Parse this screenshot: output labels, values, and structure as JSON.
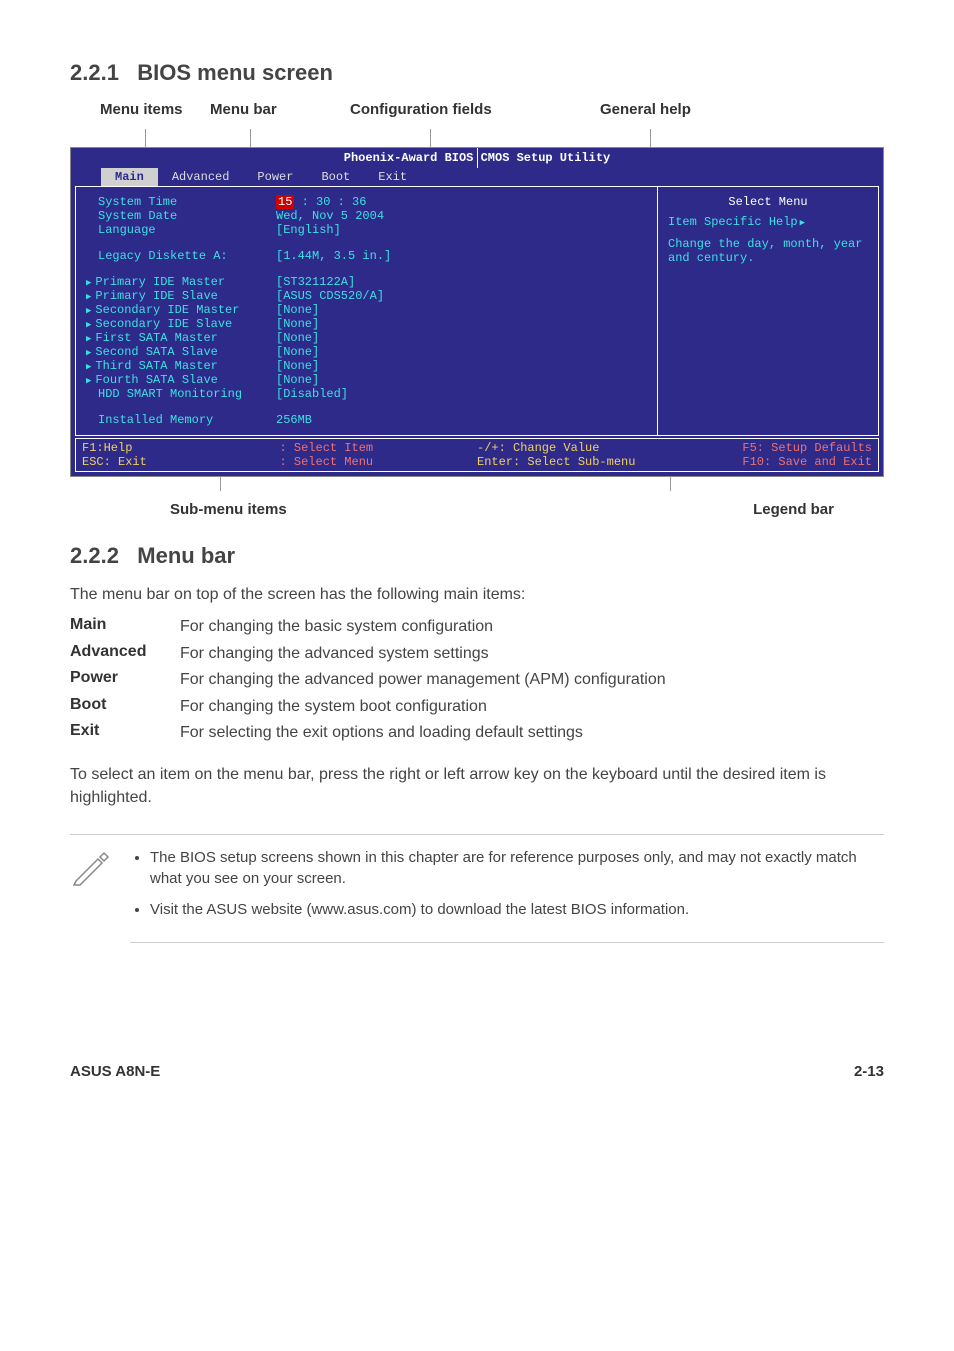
{
  "section1": {
    "number": "2.2.1",
    "title": "BIOS menu screen",
    "annotations": {
      "menu_items": "Menu items",
      "menu_bar": "Menu bar",
      "config_fields": "Configuration fields",
      "general_help": "General help",
      "submenu": "Sub-menu items",
      "legend": "Legend bar"
    }
  },
  "bios": {
    "title_left": "Phoenix-Award BIOS",
    "title_right": "CMOS Setup Utility",
    "tabs": [
      "Main",
      "Advanced",
      "Power",
      "Boot",
      "Exit"
    ],
    "active_tab": 0,
    "rows": [
      {
        "label": "System Time",
        "value_parts": {
          "h": "15",
          "m": "30",
          "s": "36"
        },
        "type": "time"
      },
      {
        "label": "System Date",
        "value": "Wed, Nov 5 2004"
      },
      {
        "label": "Language",
        "value": "[English]"
      },
      {
        "spacer": true
      },
      {
        "label": "Legacy Diskette A:",
        "value": "[1.44M, 3.5 in.]"
      },
      {
        "spacer": true
      },
      {
        "label": "Primary IDE Master",
        "value": "[ST321122A]",
        "submenu": true
      },
      {
        "label": "Primary IDE Slave",
        "value": "[ASUS CDS520/A]",
        "submenu": true
      },
      {
        "label": "Secondary IDE Master",
        "value": "[None]",
        "submenu": true
      },
      {
        "label": "Secondary IDE Slave",
        "value": "[None]",
        "submenu": true
      },
      {
        "label": "First SATA Master",
        "value": "[None]",
        "submenu": true
      },
      {
        "label": "Second SATA Slave",
        "value": "[None]",
        "submenu": true
      },
      {
        "label": "Third SATA Master",
        "value": "[None]",
        "submenu": true
      },
      {
        "label": "Fourth SATA Slave",
        "value": "[None]",
        "submenu": true
      },
      {
        "label": "HDD SMART Monitoring",
        "value": "[Disabled]"
      },
      {
        "spacer": true
      },
      {
        "label": "Installed Memory",
        "value": "256MB"
      }
    ],
    "help": {
      "title": "Select Menu",
      "item_label": "Item Specific Help",
      "text": "Change the day, month, year and century."
    },
    "footer": {
      "c1a": "F1:Help",
      "c1b": "ESC: Exit",
      "c2a": ": Select Item",
      "c2b": ": Select Menu",
      "c3a": "-/+: Change Value",
      "c3b": "Enter: Select Sub-menu",
      "c4a": "F5: Setup Defaults",
      "c4b": "F10: Save and Exit"
    }
  },
  "section2": {
    "number": "2.2.2",
    "title": "Menu bar",
    "intro": "The menu bar on top of the screen has the following main items:",
    "items": [
      {
        "label": "Main",
        "desc": "For changing the basic system configuration"
      },
      {
        "label": "Advanced",
        "desc": "For changing the advanced system settings"
      },
      {
        "label": "Power",
        "desc": "For changing the advanced power management (APM) configuration"
      },
      {
        "label": "Boot",
        "desc": "For changing the system boot configuration"
      },
      {
        "label": "Exit",
        "desc": "For selecting the exit options and loading default settings"
      }
    ],
    "outro": "To select an item on the menu bar, press the right or left arrow key on the keyboard until the desired item is highlighted."
  },
  "notes": [
    "The BIOS setup screens shown in this chapter are for reference purposes only, and may not exactly match what you see on your screen.",
    "Visit the ASUS website (www.asus.com) to download the latest BIOS information."
  ],
  "footer": {
    "left": "ASUS A8N-E",
    "right": "2-13"
  }
}
